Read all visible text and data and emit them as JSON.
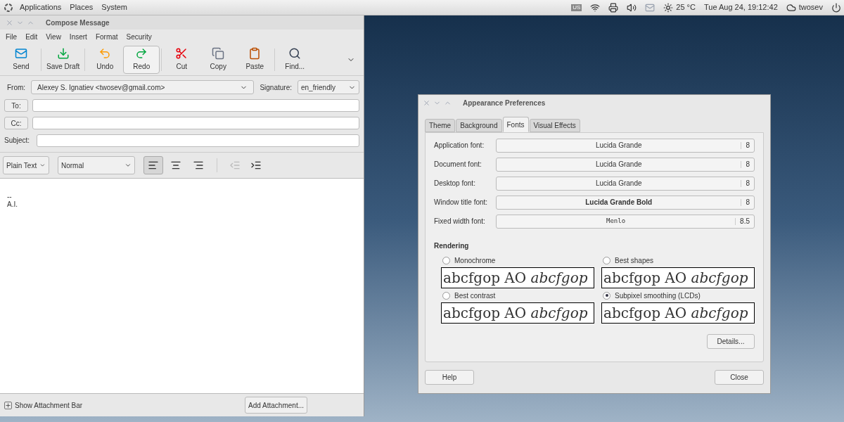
{
  "top_panel": {
    "menus": [
      "Applications",
      "Places",
      "System"
    ],
    "keyboard": "US",
    "weather": "25 °C",
    "clock": "Tue Aug 24, 19:12:42",
    "user": "twosev"
  },
  "compose": {
    "title": "Compose Message",
    "menus": [
      "File",
      "Edit",
      "View",
      "Insert",
      "Format",
      "Security"
    ],
    "toolbar": [
      {
        "kind": "send",
        "label": "Send",
        "hovered": false
      },
      {
        "kind": "save",
        "label": "Save Draft",
        "hovered": false
      },
      {
        "kind": "undo",
        "label": "Undo",
        "hovered": false
      },
      {
        "kind": "redo",
        "label": "Redo",
        "hovered": true
      },
      {
        "kind": "cut",
        "label": "Cut",
        "hovered": false
      },
      {
        "kind": "copy",
        "label": "Copy",
        "hovered": false
      },
      {
        "kind": "paste",
        "label": "Paste",
        "hovered": false
      },
      {
        "kind": "find",
        "label": "Find...",
        "hovered": false
      }
    ],
    "from_label": "From:",
    "from_value": "Alexey S. Ignatiev <twosev@gmail.com>",
    "signature_label": "Signature:",
    "signature_value": "en_friendly",
    "to_button": "To:",
    "cc_button": "Cc:",
    "subject_label": "Subject:",
    "format_value": "Plain Text",
    "paragraph_value": "Normal",
    "alignment": [
      {
        "kind": "left",
        "selected": true
      },
      {
        "kind": "center",
        "selected": false
      },
      {
        "kind": "right",
        "selected": false
      }
    ],
    "indent": [
      {
        "kind": "outdent",
        "disabled": true
      },
      {
        "kind": "indent",
        "disabled": false
      }
    ],
    "body_lines": [
      "--",
      "A.I."
    ],
    "attachment_toggle": "Show Attachment Bar",
    "add_attachment": "Add Attachment..."
  },
  "prefs": {
    "title": "Appearance Preferences",
    "tabs": [
      {
        "label": "Theme",
        "selected": false
      },
      {
        "label": "Background",
        "selected": false
      },
      {
        "label": "Fonts",
        "selected": true
      },
      {
        "label": "Visual Effects",
        "selected": false
      }
    ],
    "font_rows": [
      {
        "label": "Application font:",
        "value": "Lucida Grande",
        "size": "8",
        "kind": "normal"
      },
      {
        "label": "Document font:",
        "value": "Lucida Grande",
        "size": "8",
        "kind": "normal"
      },
      {
        "label": "Desktop font:",
        "value": "Lucida Grande",
        "size": "8",
        "kind": "normal"
      },
      {
        "label": "Window title font:",
        "value": "Lucida Grande Bold",
        "size": "8",
        "kind": "bold"
      },
      {
        "label": "Fixed width font:",
        "value": "Menlo",
        "size": "8.5",
        "kind": "mono"
      }
    ],
    "rendering_title": "Rendering",
    "options": [
      {
        "label": "Monochrome",
        "selected": false,
        "sample": "abcfgop AO *abcfgop*"
      },
      {
        "label": "Best shapes",
        "selected": false,
        "sample": "abcfgop AO *abcfgop*"
      },
      {
        "label": "Best contrast",
        "selected": false,
        "sample": "abcfgop AO *abcfgop*"
      },
      {
        "label": "Subpixel smoothing (LCDs)",
        "selected": true,
        "sample": "abcfgop AO *abcfgop*"
      }
    ],
    "details": "Details...",
    "help": "Help",
    "close": "Close"
  }
}
